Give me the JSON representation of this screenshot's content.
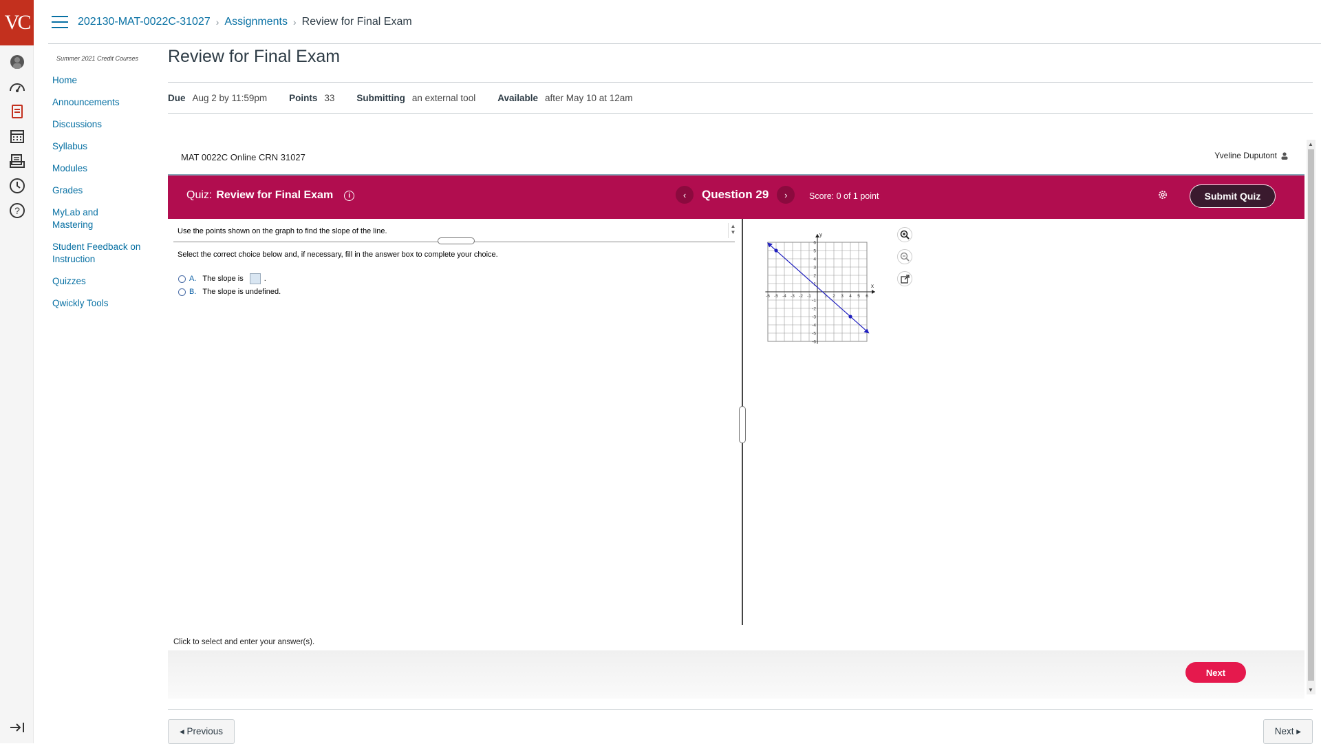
{
  "logo": "VC",
  "breadcrumb": {
    "course": "202130-MAT-0022C-31027",
    "section": "Assignments",
    "current": "Review for Final Exam"
  },
  "course_nav": {
    "term": "Summer 2021 Credit Courses",
    "items": [
      "Home",
      "Announcements",
      "Discussions",
      "Syllabus",
      "Modules",
      "Grades",
      "MyLab and Mastering",
      "Student Feedback on Instruction",
      "Quizzes",
      "Qwickly Tools"
    ]
  },
  "assignment": {
    "title": "Review for Final Exam",
    "due_label": "Due",
    "due": "Aug 2 by 11:59pm",
    "points_label": "Points",
    "points": "33",
    "submitting_label": "Submitting",
    "submitting": "an external tool",
    "available_label": "Available",
    "available": "after May 10 at 12am"
  },
  "mylab": {
    "course_line": "MAT 0022C Online CRN 31027",
    "user": "Yveline Duputont",
    "quiz_prefix": "Quiz:",
    "quiz_title": "Review for Final Exam",
    "question": "Question 29",
    "score": "Score: 0 of 1 point",
    "submit": "Submit Quiz",
    "question_text": "Use the points shown on the graph to find the slope of the line.",
    "instruction": "Select the correct choice below and, if necessary, fill in the answer box to complete your choice.",
    "choice_a_letter": "A.",
    "choice_a": "The slope is",
    "choice_b_letter": "B.",
    "choice_b": "The slope is undefined.",
    "click_msg": "Click to select and enter your answer(s).",
    "next": "Next"
  },
  "graph": {
    "xlabel": "x",
    "ylabel": "y",
    "x_ticks": [
      "-6",
      "-5",
      "-4",
      "-3",
      "-2",
      "-1",
      "1",
      "2",
      "3",
      "4",
      "5",
      "6"
    ],
    "y_ticks": [
      "6",
      "5",
      "4",
      "3",
      "2",
      "1",
      "-1",
      "-2",
      "-3",
      "-4",
      "-5",
      "-6"
    ],
    "line_color": "#1f1fbf",
    "points": [
      [
        -5,
        5
      ],
      [
        4,
        -3
      ]
    ]
  },
  "pager": {
    "previous": "◂ Previous",
    "next": "Next ▸"
  },
  "colors": {
    "quiz_bar": "#b10d4f",
    "link": "#0770a3",
    "logo_bg": "#c3301e",
    "next_btn": "#e5194d"
  }
}
